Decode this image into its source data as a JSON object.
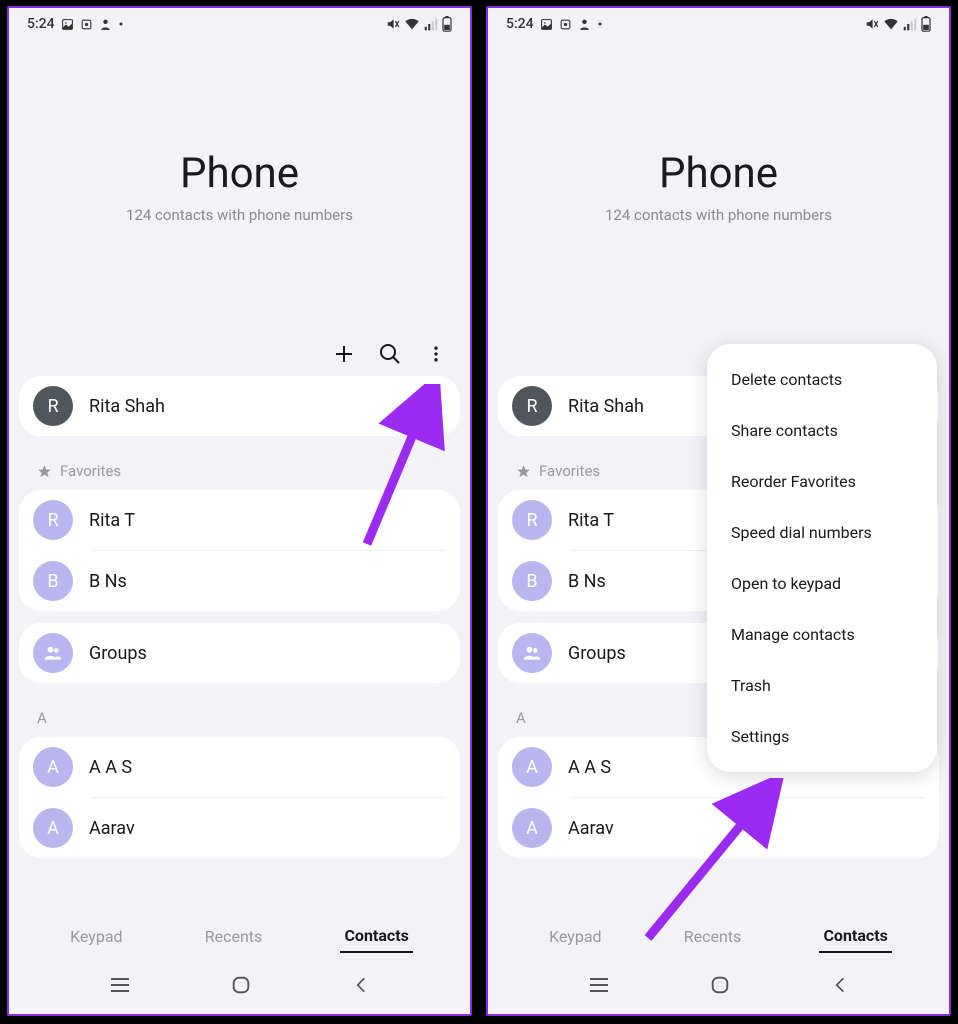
{
  "status": {
    "time": "5:24",
    "icons_left": [
      "image-icon",
      "shield-icon",
      "user-icon",
      "dot-icon"
    ],
    "icons_right": [
      "mute-icon",
      "wifi-icon",
      "signal-icon",
      "battery-icon"
    ]
  },
  "header": {
    "title": "Phone",
    "subtitle": "124 contacts with phone numbers"
  },
  "toolbar": {
    "add": "plus-icon",
    "search": "search-icon",
    "more": "more-icon"
  },
  "my_contact": {
    "initial": "R",
    "name": "Rita Shah"
  },
  "favorites_label": "Favorites",
  "favorites": [
    {
      "initial": "R",
      "name": "Rita T"
    },
    {
      "initial": "B",
      "name": "B Ns"
    }
  ],
  "groups_label": "Groups",
  "alpha_section": "A",
  "alpha_contacts": [
    {
      "initial": "A",
      "name": "A A S"
    },
    {
      "initial": "A",
      "name": "Aarav"
    }
  ],
  "tabs": {
    "keypad": "Keypad",
    "recents": "Recents",
    "contacts": "Contacts"
  },
  "overflow_menu": [
    "Delete contacts",
    "Share contacts",
    "Reorder Favorites",
    "Speed dial numbers",
    "Open to keypad",
    "Manage contacts",
    "Trash",
    "Settings"
  ]
}
